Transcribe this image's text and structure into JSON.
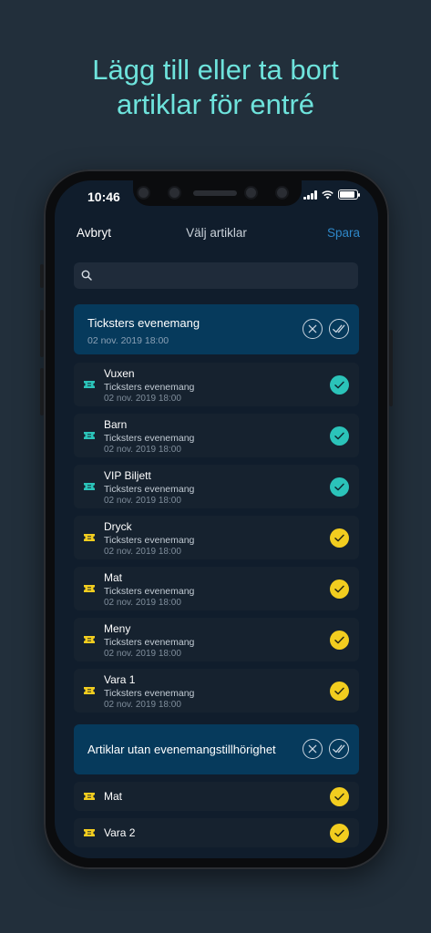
{
  "headline": [
    "Lägg till eller ta bort",
    "artiklar för entré"
  ],
  "status": {
    "time": "10:46"
  },
  "nav": {
    "cancel": "Avbryt",
    "title": "Välj artiklar",
    "save": "Spara"
  },
  "search": {
    "placeholder": "",
    "value": ""
  },
  "colors": {
    "teal": "#2bc3b9",
    "yellow": "#f2cd1f",
    "group_bg": "#063a5c",
    "row_bg": "#16222f",
    "accent": "#2e87c8"
  },
  "groups": [
    {
      "title": "Ticksters evenemang",
      "date": "02 nov. 2019 18:00",
      "items": [
        {
          "name": "Vuxen",
          "event": "Ticksters evenemang",
          "date": "02 nov. 2019 18:00",
          "type": "ticket",
          "checked": true
        },
        {
          "name": "Barn",
          "event": "Ticksters evenemang",
          "date": "02 nov. 2019 18:00",
          "type": "ticket",
          "checked": true
        },
        {
          "name": "VIP Biljett",
          "event": "Ticksters evenemang",
          "date": "02 nov. 2019 18:00",
          "type": "ticket",
          "checked": true
        },
        {
          "name": "Dryck",
          "event": "Ticksters evenemang",
          "date": "02 nov. 2019 18:00",
          "type": "product",
          "checked": true
        },
        {
          "name": "Mat",
          "event": "Ticksters evenemang",
          "date": "02 nov. 2019 18:00",
          "type": "product",
          "checked": true
        },
        {
          "name": "Meny",
          "event": "Ticksters evenemang",
          "date": "02 nov. 2019 18:00",
          "type": "product",
          "checked": true
        },
        {
          "name": "Vara 1",
          "event": "Ticksters evenemang",
          "date": "02 nov. 2019 18:00",
          "type": "product",
          "checked": true
        }
      ]
    },
    {
      "title": "Artiklar utan evenemangstillhörighet",
      "items": [
        {
          "name": "Mat",
          "type": "product",
          "checked": true
        },
        {
          "name": "Vara 2",
          "type": "product",
          "checked": true
        }
      ]
    }
  ]
}
